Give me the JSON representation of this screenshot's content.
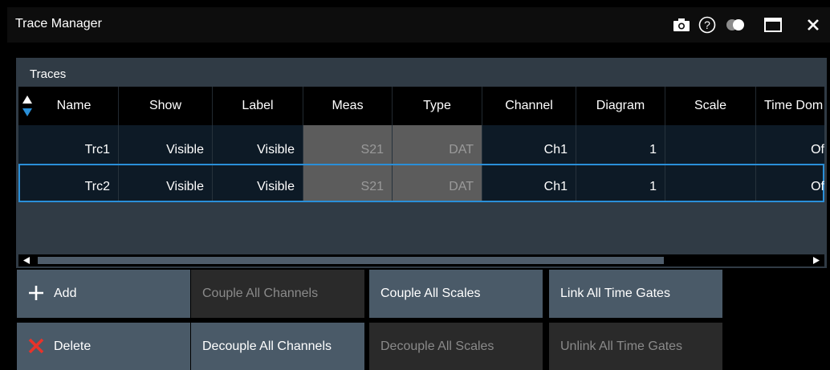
{
  "window": {
    "title": "Trace Manager"
  },
  "titlebar_icons": [
    "camera-icon",
    "help-icon",
    "transparency-icon",
    "maximize-icon",
    "close-icon"
  ],
  "traces": {
    "title": "Traces",
    "columns": [
      "Name",
      "Show",
      "Label",
      "Meas",
      "Type",
      "Channel",
      "Diagram",
      "Scale",
      "Time Dom"
    ],
    "rows": [
      {
        "name": "Trc1",
        "show": "Visible",
        "label": "Visible",
        "meas": "S21",
        "type": "DAT",
        "channel": "Ch1",
        "diagram": "1",
        "scale": "",
        "time_dom": "Of"
      },
      {
        "name": "Trc2",
        "show": "Visible",
        "label": "Visible",
        "meas": "S21",
        "type": "DAT",
        "channel": "Ch1",
        "diagram": "1",
        "scale": "",
        "time_dom": "Of"
      }
    ]
  },
  "buttons": {
    "add": "Add",
    "delete": "Delete",
    "couple_all_channels": "Couple All Channels",
    "decouple_all_channels": "Decouple All Channels",
    "couple_all_scales": "Couple All Scales",
    "decouple_all_scales": "Decouple All Scales",
    "link_all_time_gates": "Link All Time Gates",
    "unlink_all_time_gates": "Unlink All Time Gates"
  },
  "colors": {
    "accent_blue": "#2a8fd8",
    "delete_red": "#e8332a",
    "button_enabled": "#4a5a68",
    "button_disabled": "#2a2a2a"
  }
}
